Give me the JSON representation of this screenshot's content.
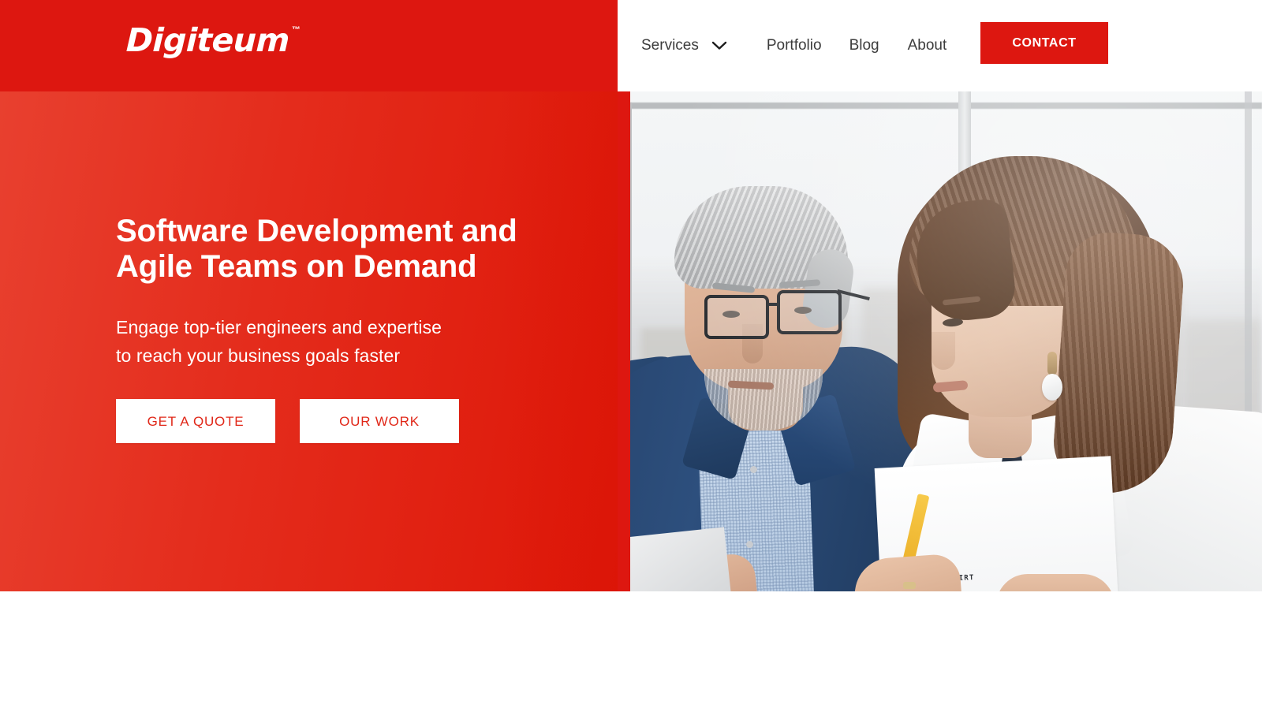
{
  "brand": {
    "logo_text": "Digiteum",
    "logo_trademark": "™",
    "primary_color": "#dd1710",
    "hero_gradient_start": "#e8402f",
    "hero_gradient_end": "#de1708"
  },
  "header": {
    "nav": [
      {
        "label": "Services",
        "has_dropdown": true,
        "icon": "chevron-down-icon"
      },
      {
        "label": "Portfolio",
        "has_dropdown": false
      },
      {
        "label": "Blog",
        "has_dropdown": false
      },
      {
        "label": "About",
        "has_dropdown": false
      }
    ],
    "contact_button": "CONTACT"
  },
  "hero": {
    "title": "Software Development and\nAgile Teams on Demand",
    "subtitle": "Engage top-tier engineers and expertise\nto reach your business goals faster",
    "buttons": [
      {
        "label": "GET A QUOTE"
      },
      {
        "label": "OUR WORK"
      }
    ],
    "image": {
      "alt": "Two colleagues reviewing work together at a desk by a window",
      "paper_text": "HIS SHIRT"
    }
  }
}
